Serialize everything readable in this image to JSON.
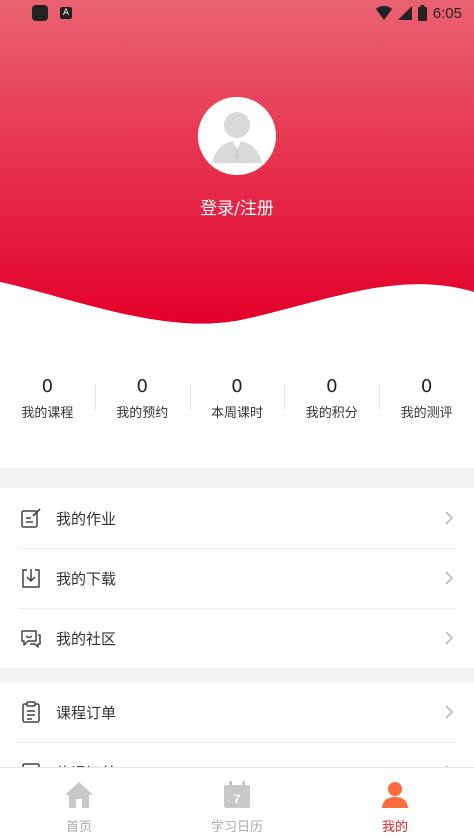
{
  "status_bar": {
    "time": "6:05"
  },
  "profile": {
    "login_label": "登录/注册"
  },
  "stats": [
    {
      "value": "0",
      "label": "我的课程"
    },
    {
      "value": "0",
      "label": "我的预约"
    },
    {
      "value": "0",
      "label": "本周课时"
    },
    {
      "value": "0",
      "label": "我的积分"
    },
    {
      "value": "0",
      "label": "我的测评"
    }
  ],
  "menu_group_1": [
    {
      "label": "我的作业",
      "icon": "homework-icon"
    },
    {
      "label": "我的下载",
      "icon": "download-icon"
    },
    {
      "label": "我的社区",
      "icon": "community-icon"
    }
  ],
  "menu_group_2": [
    {
      "label": "课程订单",
      "icon": "order-icon"
    },
    {
      "label": "约课订单",
      "icon": "booking-order-icon"
    }
  ],
  "bottom_nav": [
    {
      "label": "首页",
      "icon": "home-icon"
    },
    {
      "label": "学习日历",
      "icon": "calendar-icon",
      "badge": "7"
    },
    {
      "label": "我的",
      "icon": "profile-icon"
    }
  ],
  "colors": {
    "brand_red": "#e4232f",
    "header_top": "#ea6272",
    "header_bottom": "#e4002b",
    "active_orange": "#ff6a3d"
  }
}
